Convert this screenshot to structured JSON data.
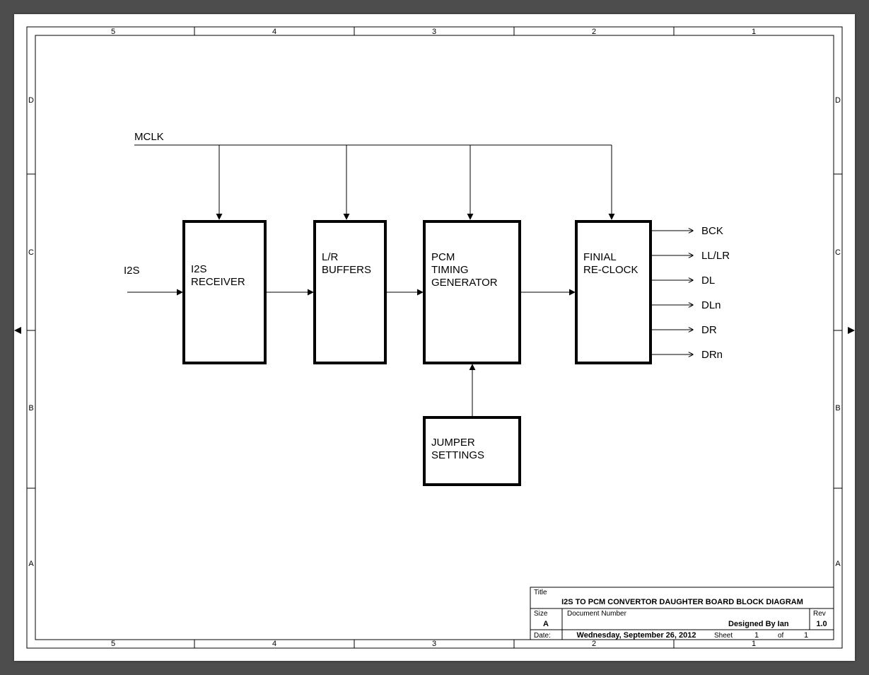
{
  "signals": {
    "mclk": "MCLK",
    "i2s": "I2S",
    "outputs": [
      "BCK",
      "LL/LR",
      "DL",
      "DLn",
      "DR",
      "DRn"
    ]
  },
  "blocks": {
    "i2s_receiver": "I2S\nRECEIVER",
    "lr_buffers": "L/R\nBUFFERS",
    "pcm_timing": "PCM\nTIMING\nGENERATOR",
    "final_reclock": "FINIAL\nRE-CLOCK",
    "jumper": "JUMPER\nSETTINGS"
  },
  "frame": {
    "cols_top": [
      "5",
      "4",
      "3",
      "2",
      "1"
    ],
    "cols_bot": [
      "5",
      "4",
      "3",
      "2",
      "1"
    ],
    "rows_left": [
      "D",
      "C",
      "B",
      "A"
    ],
    "rows_right": [
      "D",
      "C",
      "B",
      "A"
    ]
  },
  "titleblock": {
    "title_label": "Title",
    "title": "I2S TO PCM CONVERTOR DAUGHTER BOARD BLOCK DIAGRAM",
    "size_label": "Size",
    "size": "A",
    "docnum_label": "Document Number",
    "designed_by": "Designed By Ian",
    "rev_label": "Rev",
    "rev": "1.0",
    "date_label": "Date:",
    "date": "Wednesday, September 26, 2012",
    "sheet_label": "Sheet",
    "sheet_n": "1",
    "sheet_of": "of",
    "sheet_total": "1"
  }
}
